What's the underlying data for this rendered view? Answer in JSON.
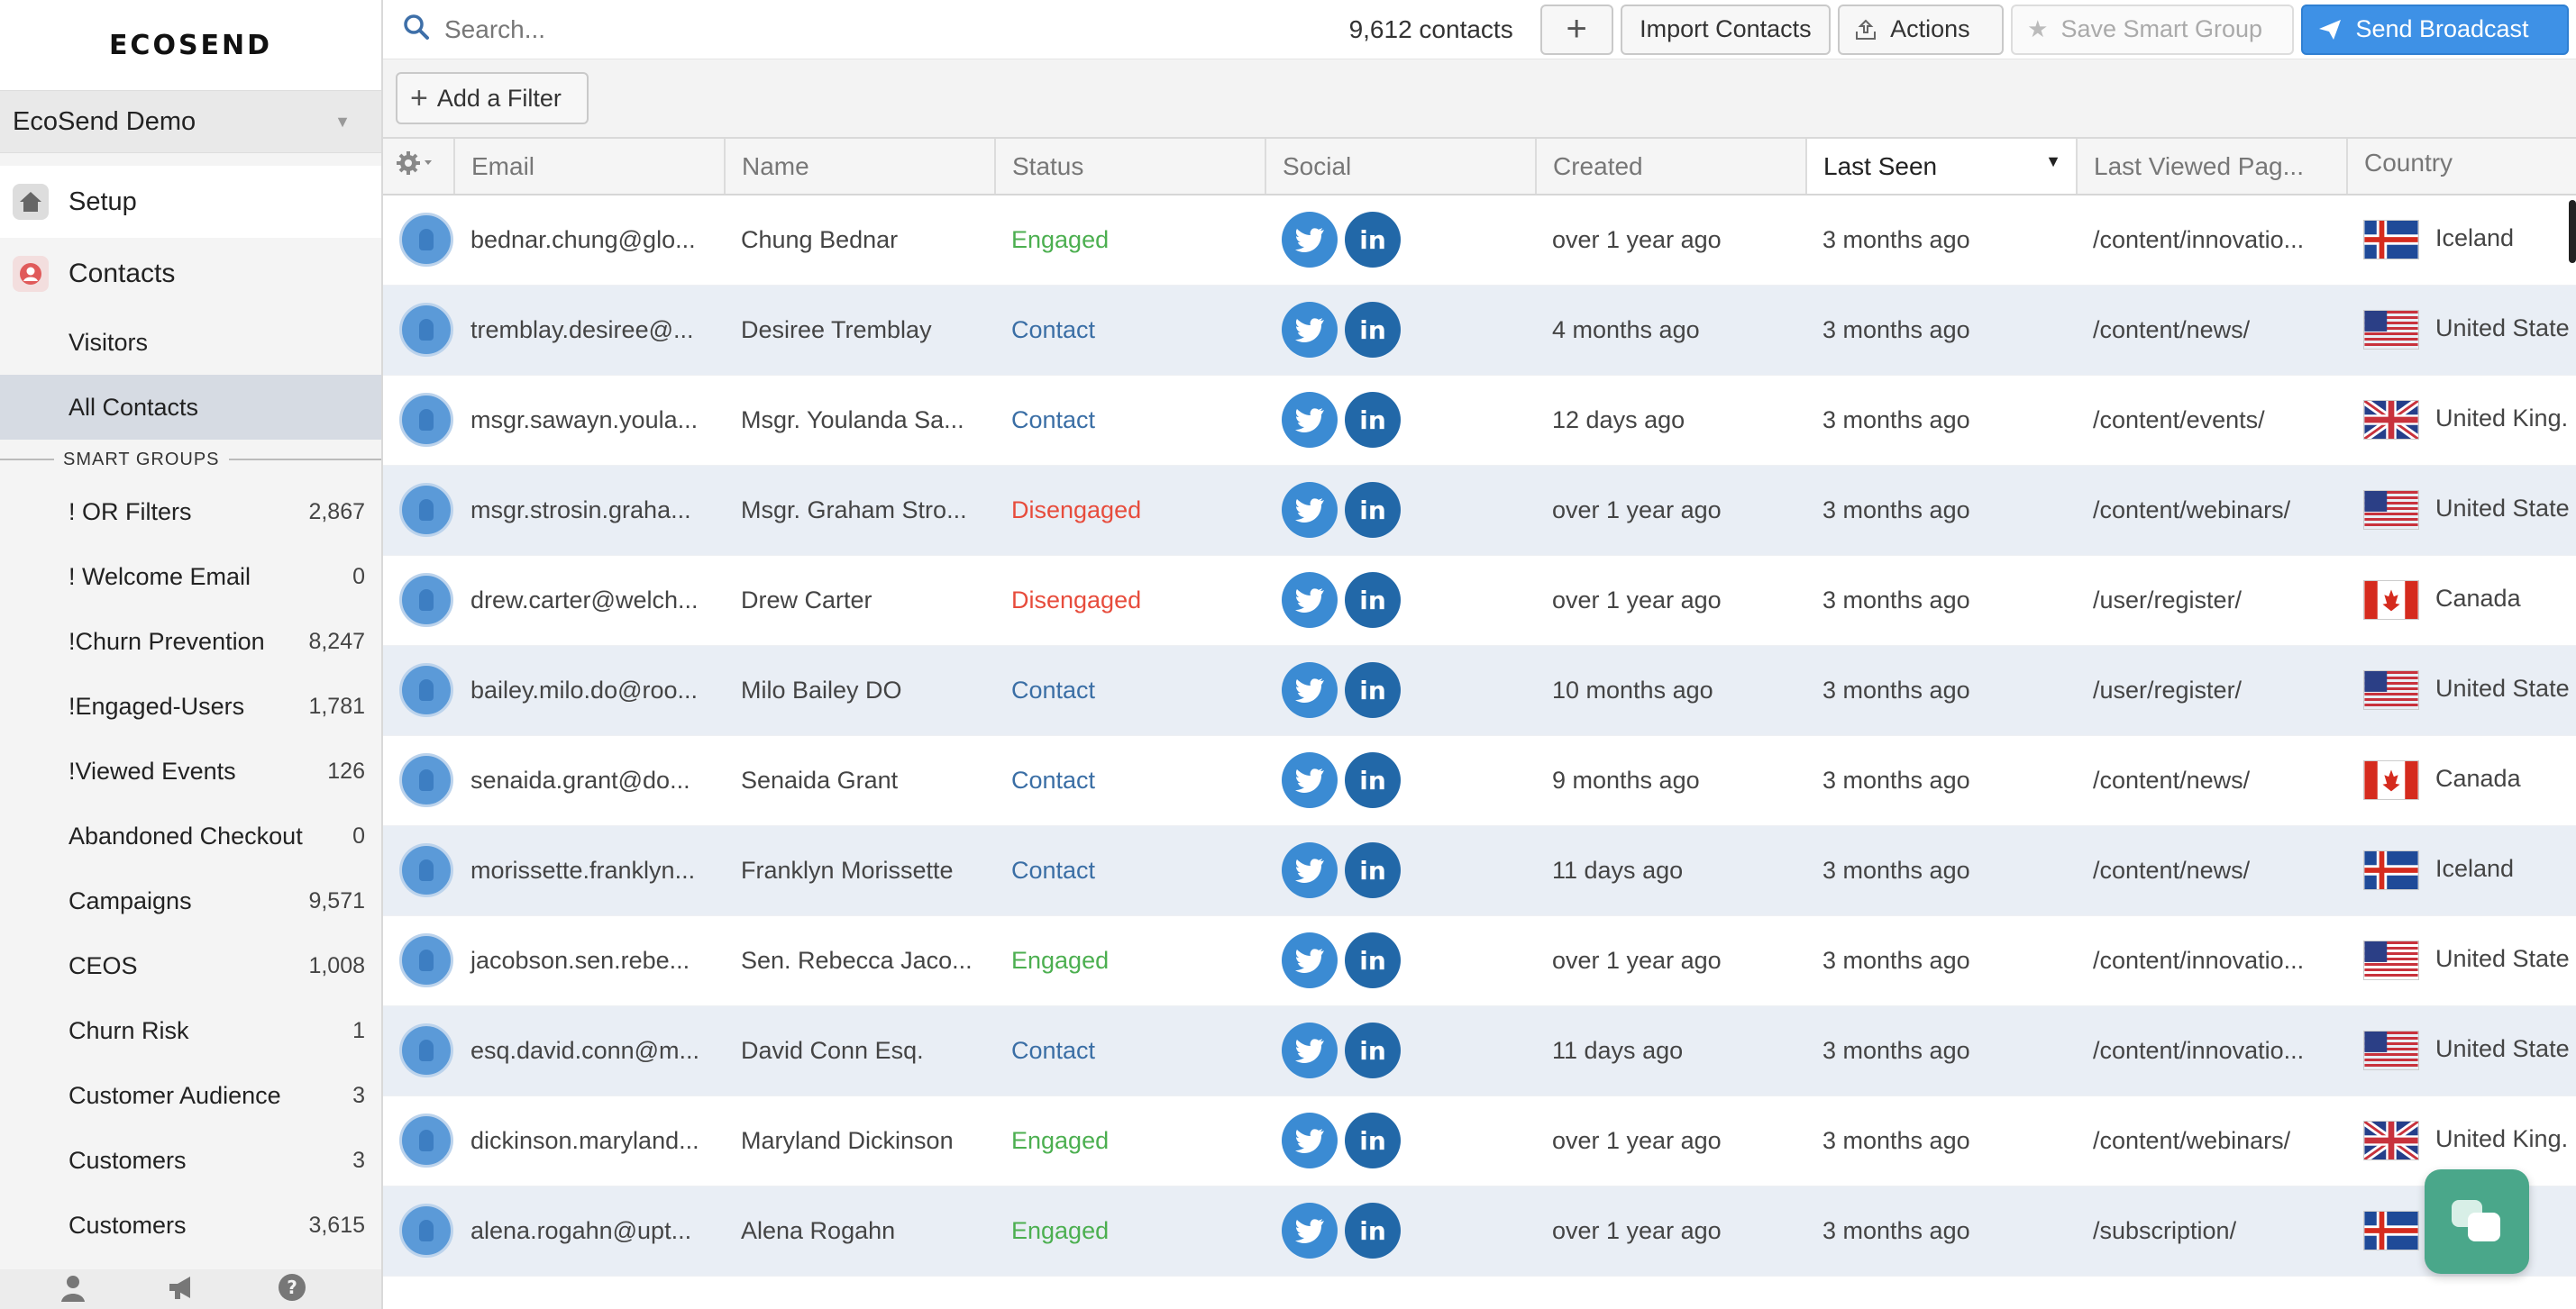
{
  "app": {
    "logo": "ECOSEND",
    "workspace": "EcoSend Demo"
  },
  "sidebar": {
    "setup_label": "Setup",
    "contacts_label": "Contacts",
    "visitors_label": "Visitors",
    "all_contacts_label": "All Contacts",
    "smart_groups_header": "SMART GROUPS",
    "smart_groups": [
      {
        "label": "! OR Filters",
        "count": "2,867"
      },
      {
        "label": "! Welcome Email",
        "count": "0"
      },
      {
        "label": "!Churn Prevention",
        "count": "8,247"
      },
      {
        "label": "!Engaged-Users",
        "count": "1,781"
      },
      {
        "label": "!Viewed Events",
        "count": "126"
      },
      {
        "label": "Abandoned Checkout",
        "count": "0"
      },
      {
        "label": "Campaigns",
        "count": "9,571"
      },
      {
        "label": "CEOS",
        "count": "1,008"
      },
      {
        "label": "Churn Risk",
        "count": "1"
      },
      {
        "label": "Customer Audience",
        "count": "3"
      },
      {
        "label": "Customers",
        "count": "3"
      },
      {
        "label": "Customers",
        "count": "3,615"
      }
    ],
    "footer_icons": [
      "user-icon",
      "megaphone-icon",
      "help-icon"
    ]
  },
  "toolbar": {
    "search_placeholder": "Search...",
    "contact_count": "9,612 contacts",
    "add_label": "+",
    "import_label": "Import Contacts",
    "actions_label": "Actions",
    "save_label": "Save Smart Group",
    "broadcast_label": "Send Broadcast",
    "filter_label": "Add a Filter"
  },
  "table": {
    "headers": {
      "email": "Email",
      "name": "Name",
      "status": "Status",
      "social": "Social",
      "created": "Created",
      "last_seen": "Last Seen",
      "last_viewed": "Last Viewed Pag...",
      "country": "Country"
    },
    "rows": [
      {
        "email": "bednar.chung@glo...",
        "name": "Chung Bednar",
        "status": "Engaged",
        "created": "over 1 year ago",
        "last_seen": "3 months ago",
        "page": "/content/innovatio...",
        "country": "Iceland",
        "flag": "is"
      },
      {
        "email": "tremblay.desiree@...",
        "name": "Desiree Tremblay",
        "status": "Contact",
        "created": "4 months ago",
        "last_seen": "3 months ago",
        "page": "/content/news/",
        "country": "United State",
        "flag": "us"
      },
      {
        "email": "msgr.sawayn.youla...",
        "name": "Msgr. Youlanda Sa...",
        "status": "Contact",
        "created": "12 days ago",
        "last_seen": "3 months ago",
        "page": "/content/events/",
        "country": "United King.",
        "flag": "uk"
      },
      {
        "email": "msgr.strosin.graha...",
        "name": "Msgr. Graham Stro...",
        "status": "Disengaged",
        "created": "over 1 year ago",
        "last_seen": "3 months ago",
        "page": "/content/webinars/",
        "country": "United State",
        "flag": "us"
      },
      {
        "email": "drew.carter@welch...",
        "name": "Drew Carter",
        "status": "Disengaged",
        "created": "over 1 year ago",
        "last_seen": "3 months ago",
        "page": "/user/register/",
        "country": "Canada",
        "flag": "ca"
      },
      {
        "email": "bailey.milo.do@roo...",
        "name": "Milo Bailey DO",
        "status": "Contact",
        "created": "10 months ago",
        "last_seen": "3 months ago",
        "page": "/user/register/",
        "country": "United State",
        "flag": "us"
      },
      {
        "email": "senaida.grant@do...",
        "name": "Senaida Grant",
        "status": "Contact",
        "created": "9 months ago",
        "last_seen": "3 months ago",
        "page": "/content/news/",
        "country": "Canada",
        "flag": "ca"
      },
      {
        "email": "morissette.franklyn...",
        "name": "Franklyn Morissette",
        "status": "Contact",
        "created": "11 days ago",
        "last_seen": "3 months ago",
        "page": "/content/news/",
        "country": "Iceland",
        "flag": "is"
      },
      {
        "email": "jacobson.sen.rebe...",
        "name": "Sen. Rebecca Jaco...",
        "status": "Engaged",
        "created": "over 1 year ago",
        "last_seen": "3 months ago",
        "page": "/content/innovatio...",
        "country": "United State",
        "flag": "us"
      },
      {
        "email": "esq.david.conn@m...",
        "name": "David Conn Esq.",
        "status": "Contact",
        "created": "11 days ago",
        "last_seen": "3 months ago",
        "page": "/content/innovatio...",
        "country": "United State",
        "flag": "us"
      },
      {
        "email": "dickinson.maryland...",
        "name": "Maryland Dickinson",
        "status": "Engaged",
        "created": "over 1 year ago",
        "last_seen": "3 months ago",
        "page": "/content/webinars/",
        "country": "United King.",
        "flag": "uk"
      },
      {
        "email": "alena.rogahn@upt...",
        "name": "Alena Rogahn",
        "status": "Engaged",
        "created": "over 1 year ago",
        "last_seen": "3 months ago",
        "page": "/subscription/",
        "country": "",
        "flag": "is"
      }
    ]
  },
  "colors": {
    "accent": "#3e91e6",
    "engaged": "#4caf50",
    "contact": "#3a6ea5",
    "disengaged": "#e74c3c",
    "chat": "#4aa78a"
  }
}
